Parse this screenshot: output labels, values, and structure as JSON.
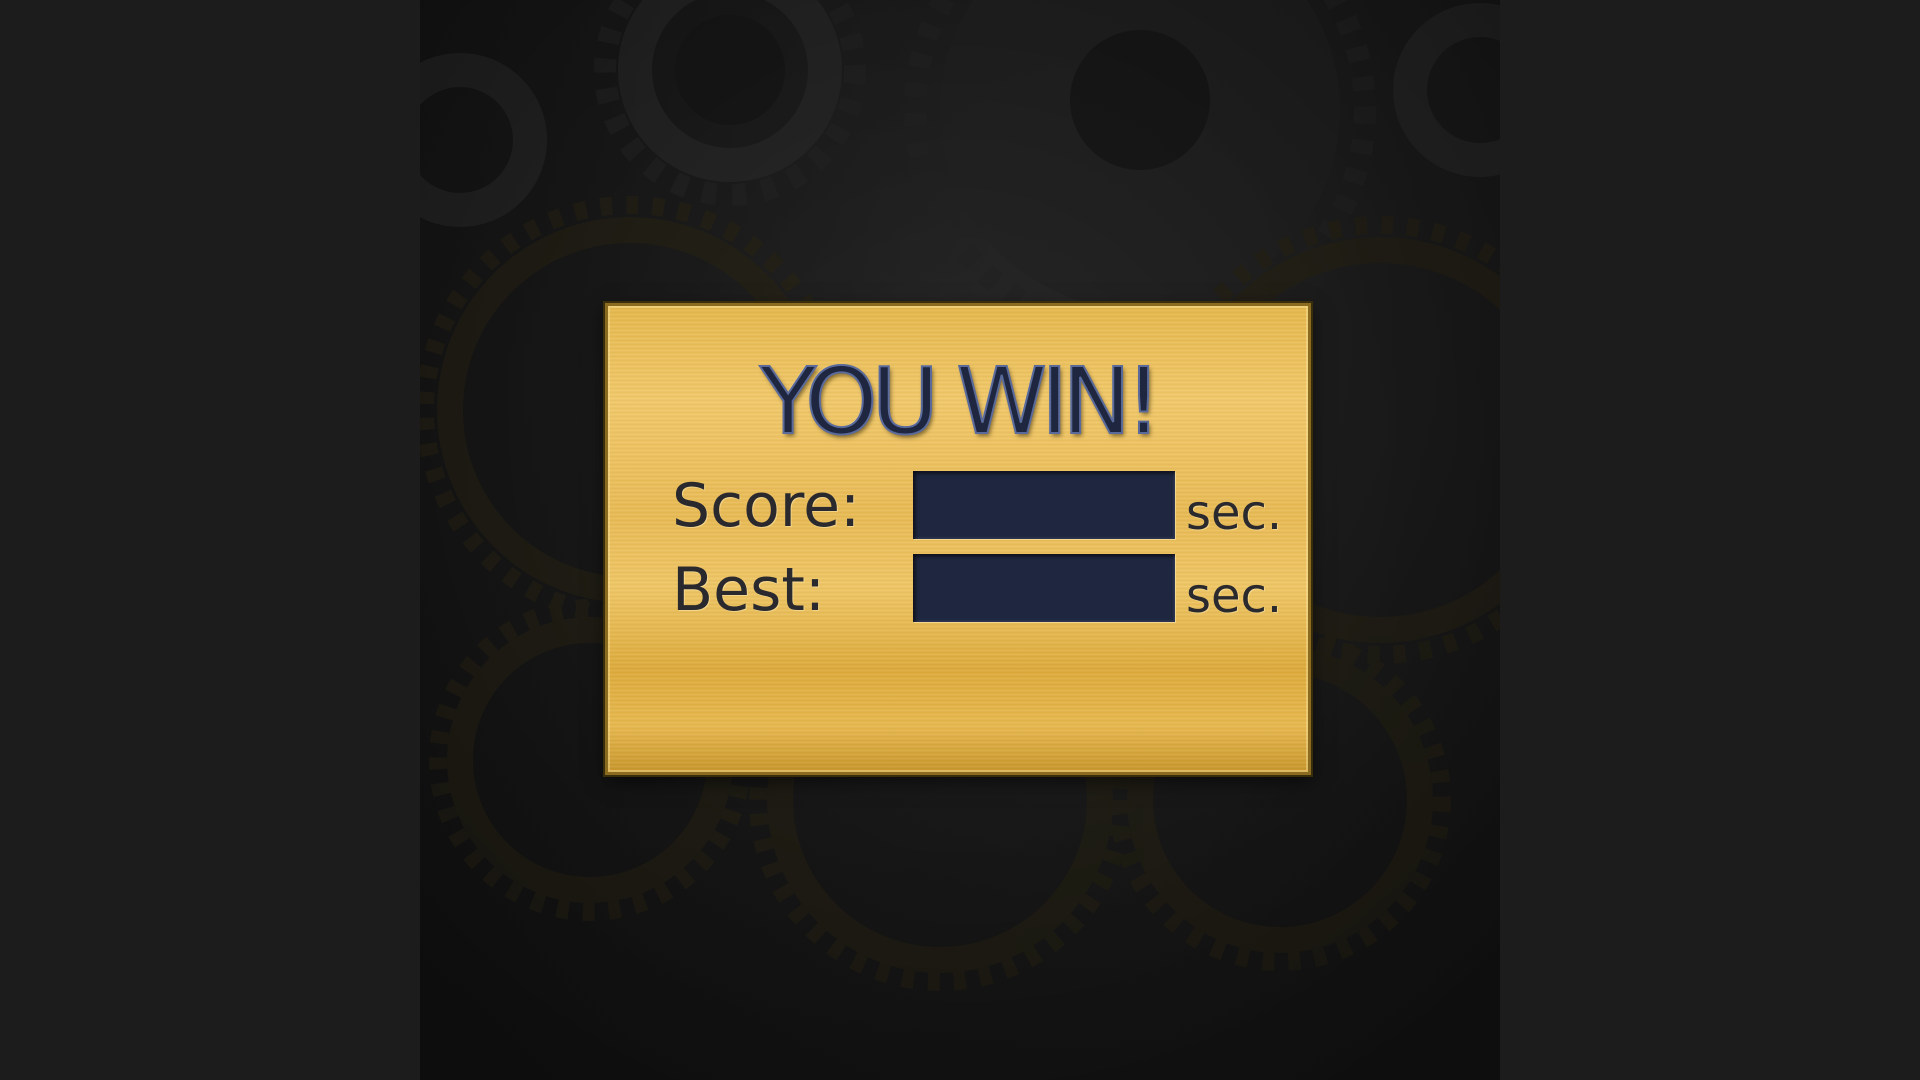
{
  "window": {
    "background_color": "#1c1c1c"
  },
  "win_panel": {
    "title": "YOU WIN!",
    "score": {
      "label": "Score:",
      "value": "",
      "unit": "sec."
    },
    "best": {
      "label": "Best:",
      "value": "",
      "unit": "sec."
    },
    "plaque_color": "#e9bb55",
    "text_color": "#2a2a2e",
    "title_color": "#1e2640",
    "value_box_color": "#1f2740"
  }
}
